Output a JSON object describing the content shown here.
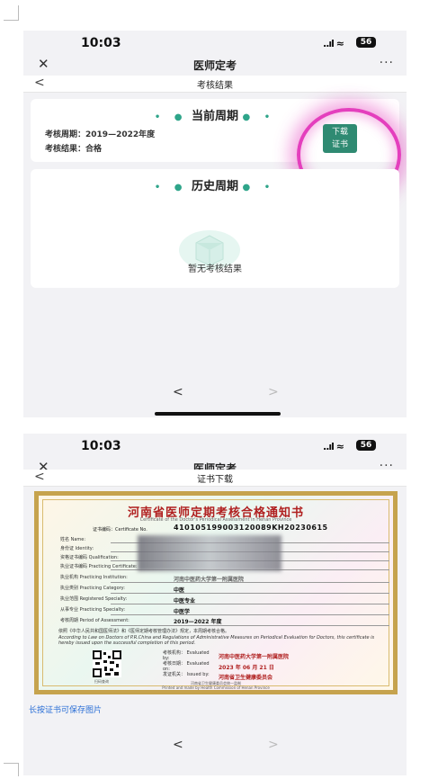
{
  "screen1": {
    "status": {
      "time": "10:03",
      "signal": "..ıl",
      "wifi": "≈",
      "battery": "56"
    },
    "app_title": "医师定考",
    "sub_title": "考核结果",
    "current": {
      "heading": "当前周期",
      "period_label": "考核周期：",
      "period_value": "2019—2022年度",
      "result_label": "考核结果：",
      "result_value": "合格",
      "download_line1": "下载",
      "download_line2": "证书"
    },
    "history": {
      "heading": "历史周期",
      "empty_text": "暂无考核结果"
    },
    "nav": {
      "back": "<",
      "forward": ">"
    }
  },
  "screen2": {
    "status": {
      "time": "10:03",
      "signal": "..ıl",
      "wifi": "≈",
      "battery": "56"
    },
    "app_title": "医师定考",
    "sub_title": "证书下载",
    "certificate": {
      "title": "河南省医师定期考核合格通知书",
      "subtitle": "Certificate of the Doctor's Periodical Assessment in Henan Province",
      "no_label": "证书编码：Certificate No.",
      "no_value": "410105199003120089KH20230615",
      "fields": [
        {
          "label": "姓名 Name:",
          "value": ""
        },
        {
          "label": "身份证 Identity:",
          "value": ""
        },
        {
          "label": "资格证书编码 Qualification:",
          "value": ""
        },
        {
          "label": "执业证书编码 Practicing Certificate:",
          "value": ""
        },
        {
          "label": "执业机构 Practicing Institution:",
          "value": "河南中医药大学第一附属医院"
        },
        {
          "label": "执业类别 Practicing Category:",
          "value": "中医"
        },
        {
          "label": "执业范围 Registered Specialty:",
          "value": "中医专业"
        },
        {
          "label": "从事专业 Practicing Specialty:",
          "value": "中医学"
        },
        {
          "label": "考核周期 Period of Assessment:",
          "value": "2019—2022 年度"
        }
      ],
      "note_cn": "依照《中华人民共和国医师法》和《医师定期考核管理办法》规定，本周期考核合格。",
      "note_en": "According to Law on Doctors of P.R.China and Regulations of Administrative Measures on Periodical Evaluation for Doctors, this certificate is hereby issued upon the successful completion of this period.",
      "qr_caption": "扫码查询",
      "evaluated_by_label": "考核机构： Evaluated by:",
      "evaluated_by_value": "河南中医药大学第一附属医院",
      "evaluated_on_label": "考核日期： Evaluated on:",
      "evaluated_on_value": "2023 年 06 月 21 日",
      "issued_by_label": "发证机关： Issued by:",
      "issued_by_value": "河南省卫生健康委员会",
      "footer_cn": "河南省卫生健康委员会统一监制",
      "footer_en": "Printed and made by Health Commission of Henan Province"
    },
    "save_hint": "长按证书可保存图片",
    "nav": {
      "back": "<",
      "forward": ">"
    }
  },
  "colors": {
    "accent": "#2fa58a",
    "button": "#2f8a72",
    "highlight": "#e43fbd",
    "cert_title": "#b02020",
    "link": "#2b6fd6"
  }
}
